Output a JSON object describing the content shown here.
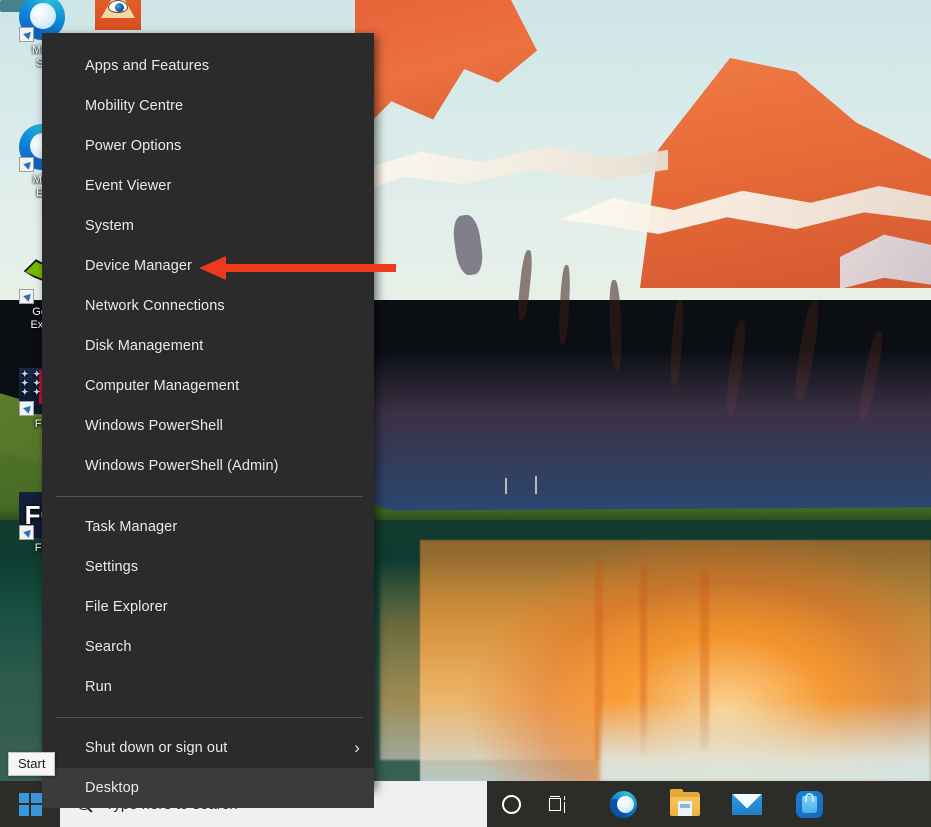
{
  "desktop": {
    "icons": [
      {
        "label": "Mi S\nSh",
        "icon": "microsoft-edge-shortcut-icon"
      },
      {
        "label": "",
        "icon": "irfanview-icon"
      },
      {
        "label": "Micr\nEd",
        "icon": "microsoft-edge-shortcut-icon"
      },
      {
        "label": "GeF\nExpe",
        "icon": "nvidia-geforce-experience-icon"
      },
      {
        "label": "Far",
        "icon": "farming-simulator-shortcut-icon"
      },
      {
        "label": "Far",
        "icon": "farming-simulator-shortcut-icon"
      }
    ]
  },
  "winx_menu": {
    "name": "win-x-power-user-menu",
    "groups": [
      {
        "items": [
          {
            "label": "Apps and Features",
            "submenu": false,
            "selected": false
          },
          {
            "label": "Mobility Centre",
            "submenu": false,
            "selected": false
          },
          {
            "label": "Power Options",
            "submenu": false,
            "selected": false
          },
          {
            "label": "Event Viewer",
            "submenu": false,
            "selected": false
          },
          {
            "label": "System",
            "submenu": false,
            "selected": false
          },
          {
            "label": "Device Manager",
            "submenu": false,
            "selected": false
          },
          {
            "label": "Network Connections",
            "submenu": false,
            "selected": false
          },
          {
            "label": "Disk Management",
            "submenu": false,
            "selected": false
          },
          {
            "label": "Computer Management",
            "submenu": false,
            "selected": false
          },
          {
            "label": "Windows PowerShell",
            "submenu": false,
            "selected": false
          },
          {
            "label": "Windows PowerShell (Admin)",
            "submenu": false,
            "selected": false
          }
        ]
      },
      {
        "items": [
          {
            "label": "Task Manager",
            "submenu": false,
            "selected": false
          },
          {
            "label": "Settings",
            "submenu": false,
            "selected": false
          },
          {
            "label": "File Explorer",
            "submenu": false,
            "selected": false
          },
          {
            "label": "Search",
            "submenu": false,
            "selected": false
          },
          {
            "label": "Run",
            "submenu": false,
            "selected": false
          }
        ]
      },
      {
        "items": [
          {
            "label": "Shut down or sign out",
            "submenu": true,
            "selected": false,
            "chevron": "›"
          },
          {
            "label": "Desktop",
            "submenu": false,
            "selected": true
          }
        ]
      }
    ]
  },
  "annotation": {
    "type": "arrow",
    "color": "#ed3a1c",
    "points_to": "Device Manager",
    "direction": "left"
  },
  "tooltip": {
    "label": "Start"
  },
  "taskbar": {
    "start_button_label": "Start",
    "start_icon": "windows-logo-icon",
    "search": {
      "placeholder": "Type here to search",
      "value": "",
      "icon": "search-icon"
    },
    "icons": [
      {
        "name": "cortana-icon",
        "label": "Cortana"
      },
      {
        "name": "task-view-icon",
        "label": "Task View"
      },
      {
        "name": "microsoft-edge-icon",
        "label": "Microsoft Edge"
      },
      {
        "name": "file-explorer-icon",
        "label": "File Explorer"
      },
      {
        "name": "mail-icon",
        "label": "Mail"
      },
      {
        "name": "microsoft-store-icon",
        "label": "Microsoft Store"
      }
    ]
  },
  "colors": {
    "menu_background": "#2b2b2b",
    "menu_highlight": "#3b3b3b",
    "menu_text": "#eaeaea",
    "menu_separator": "#555555",
    "taskbar_background": "#2c2d29",
    "search_background": "#eff0f1",
    "accent_blue": "#3a96dd",
    "annotation_red": "#ed3a1c",
    "tooltip_background": "#f6f6f6"
  }
}
